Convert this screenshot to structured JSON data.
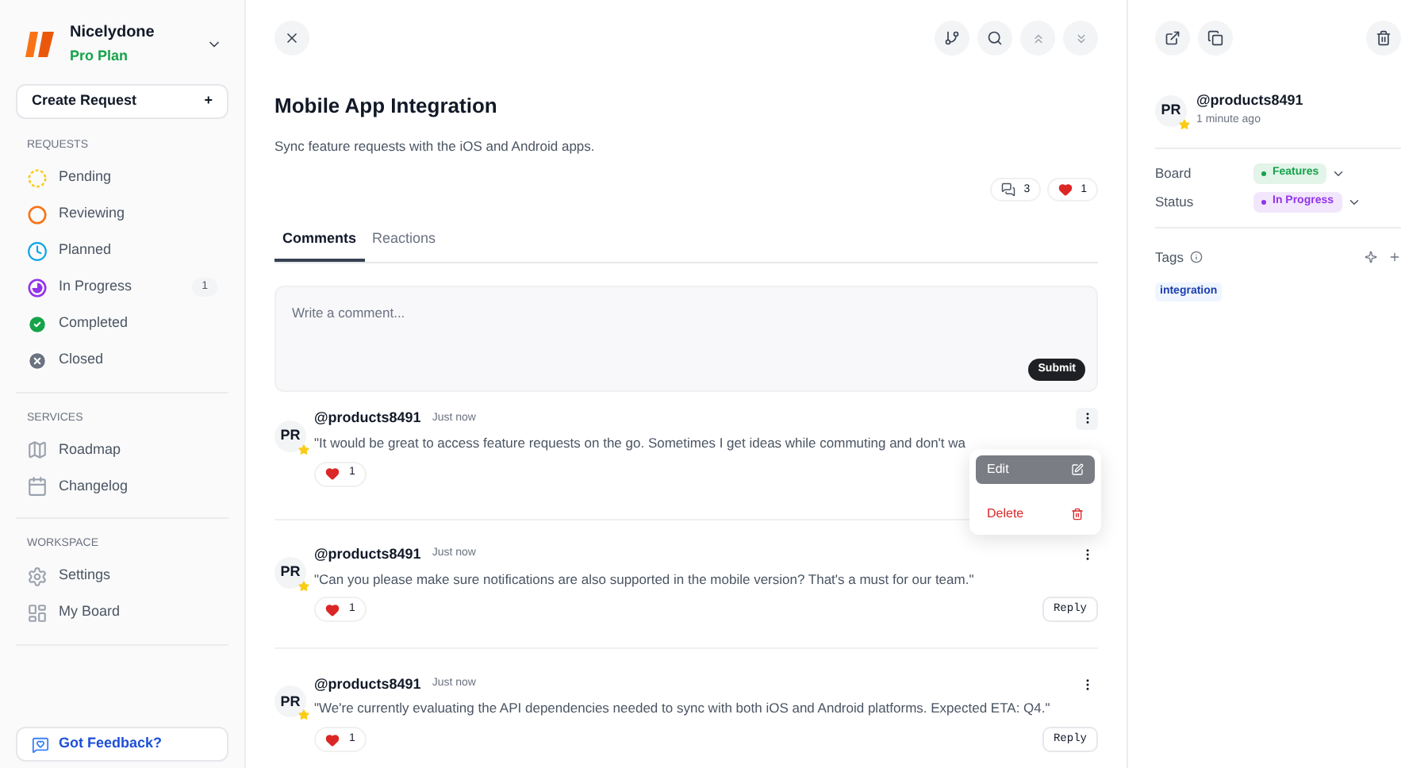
{
  "workspace": {
    "name": "Nicelydone",
    "plan": "Pro Plan"
  },
  "create_button": {
    "label": "Create Request",
    "icon": "+"
  },
  "sidebar": [
    {
      "heading": "REQUESTS",
      "items": [
        {
          "label": "Pending",
          "kind": "pending"
        },
        {
          "label": "Reviewing",
          "kind": "reviewing"
        },
        {
          "label": "Planned",
          "kind": "planned"
        },
        {
          "label": "In Progress",
          "kind": "progress",
          "count": "1"
        },
        {
          "label": "Completed",
          "kind": "completed"
        },
        {
          "label": "Closed",
          "kind": "closed"
        }
      ]
    },
    {
      "heading": "SERVICES",
      "items": [
        {
          "label": "Roadmap",
          "kind": "roadmap"
        },
        {
          "label": "Changelog",
          "kind": "changelog"
        }
      ]
    },
    {
      "heading": "WORKSPACE",
      "items": [
        {
          "label": "Settings",
          "kind": "settings"
        },
        {
          "label": "My Board",
          "kind": "board"
        }
      ]
    }
  ],
  "feedback_button": "Got Feedback?",
  "request": {
    "title": "Mobile App Integration",
    "description": "Sync feature requests with the iOS and Android apps.",
    "comment_count": "3",
    "reaction_count": "1"
  },
  "tabs": [
    {
      "label": "Comments",
      "selected": true
    },
    {
      "label": "Reactions",
      "selected": false
    }
  ],
  "comment_box": {
    "placeholder": "Write a comment...",
    "submit": "Submit"
  },
  "comments": [
    {
      "initials": "PR",
      "author": "@products8491",
      "time": "Just now",
      "text": "\"It would be great to access feature requests on the go. Sometimes I get ideas while commuting and don't wa",
      "likes": "1"
    },
    {
      "initials": "PR",
      "author": "@products8491",
      "time": "Just now",
      "text": "\"Can you please make sure notifications are also supported in the mobile version? That's a must for our team.\"",
      "likes": "1",
      "reply": "Reply"
    },
    {
      "initials": "PR",
      "author": "@products8491",
      "time": "Just now",
      "text": "\"We're currently evaluating the API dependencies needed to sync with both iOS and Android platforms. Expected ETA: Q4.\"",
      "likes": "1",
      "reply": "Reply"
    }
  ],
  "comment_menu": [
    {
      "label": "Edit",
      "kind": "edit",
      "selected": true
    },
    {
      "label": "Delete",
      "kind": "delete",
      "selected": false
    }
  ],
  "details": {
    "initials": "PR",
    "author": "@products8491",
    "time": "1 minute ago",
    "fields": [
      {
        "label": "Board",
        "value": "Features",
        "color": "#16a34a"
      },
      {
        "label": "Status",
        "value": "In Progress",
        "color": "#9333ea"
      }
    ],
    "tags_label": "Tags",
    "tags": [
      "integration"
    ]
  }
}
